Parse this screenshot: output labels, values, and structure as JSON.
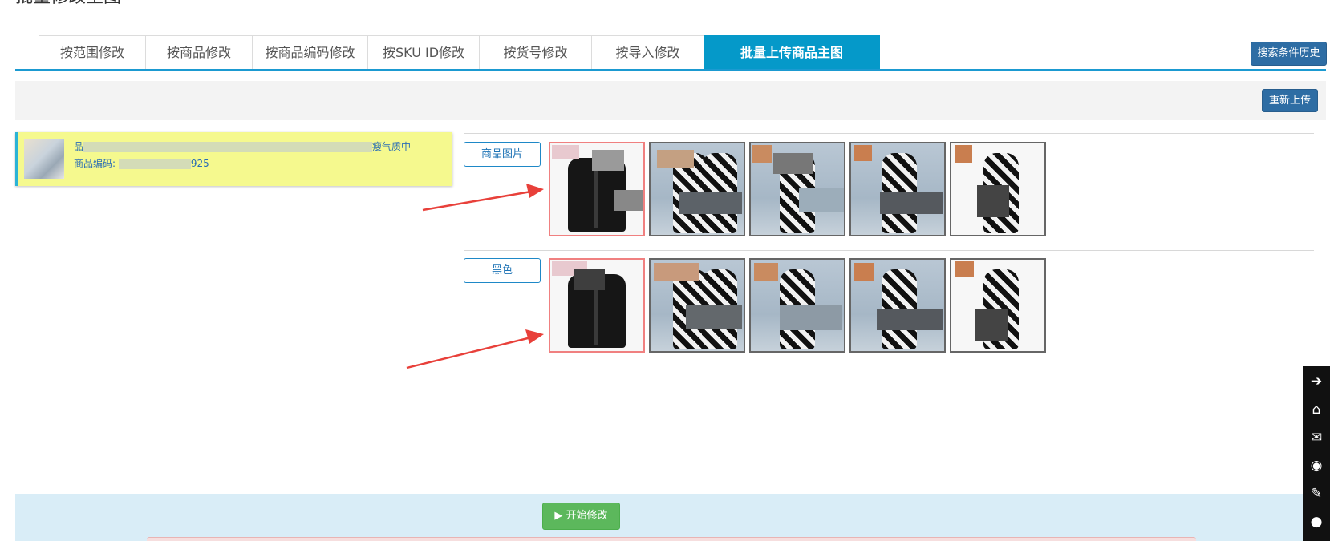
{
  "page": {
    "title": "批量修改主图"
  },
  "tabs": [
    {
      "label": "按范围修改"
    },
    {
      "label": "按商品修改"
    },
    {
      "label": "按商品编码修改"
    },
    {
      "label": "按SKU ID修改"
    },
    {
      "label": "按货号修改"
    },
    {
      "label": "按导入修改"
    },
    {
      "label": "批量上传商品主图",
      "active": true
    }
  ],
  "toolbar": {
    "history_label": "搜索条件历史",
    "reupload_label": "重新上传"
  },
  "product": {
    "name_prefix": "品",
    "name_suffix": "瘦气质中",
    "code_label": "商品编码:",
    "code_suffix": "925"
  },
  "groups": [
    {
      "label": "商品图片"
    },
    {
      "label": "黑色"
    }
  ],
  "actions": {
    "start_label": "▶ 开始修改"
  },
  "sidebar": {
    "icons": [
      "arrow-right-icon",
      "home-icon",
      "mail-icon",
      "chat-icon",
      "edit-icon",
      "wechat-icon"
    ]
  },
  "colors": {
    "tab_active": "#0599c9",
    "primary_button": "#2e6da4",
    "success_button": "#5cb85c",
    "card_highlight": "#f5f98e",
    "footer_bar": "#d9edf7",
    "annotation_arrow": "#e8403a"
  }
}
